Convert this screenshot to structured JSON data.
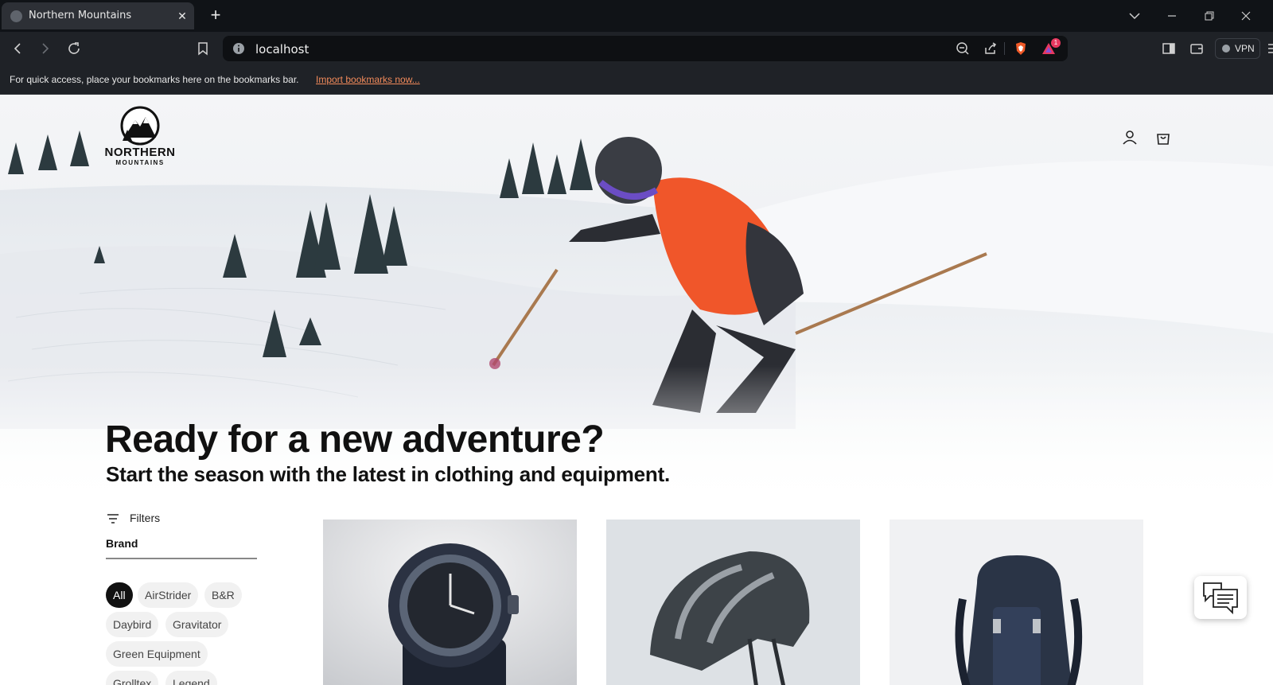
{
  "browser": {
    "tab_title": "Northern Mountains",
    "new_tab_symbol": "+",
    "close_symbol": "✕",
    "url": "localhost",
    "vpn_label": "VPN",
    "notification_count": "1",
    "bookmarks_bar_text": "For quick access, place your bookmarks here on the bookmarks bar.",
    "bookmarks_import_link": "Import bookmarks now..."
  },
  "site": {
    "logo_line1": "NORTHERN",
    "logo_line2": "MOUNTAINS",
    "hero_title": "Ready for a new adventure?",
    "hero_subtitle": "Start the season with the latest in clothing and equipment."
  },
  "filters": {
    "label": "Filters",
    "brand_label": "Brand",
    "brands": [
      "All",
      "AirStrider",
      "B&R",
      "Daybird",
      "Gravitator",
      "Green Equipment",
      "Grolltex",
      "Legend"
    ],
    "selected": "All"
  },
  "products": [
    {
      "icon": "watch-image"
    },
    {
      "icon": "helmet-image"
    },
    {
      "icon": "backpack-image"
    }
  ],
  "colors": {
    "chrome_dark": "#101317",
    "chrome_mid": "#1f2227",
    "link_orange": "#f38b5b",
    "jacket_orange": "#f0562a",
    "text_dark": "#111111"
  }
}
